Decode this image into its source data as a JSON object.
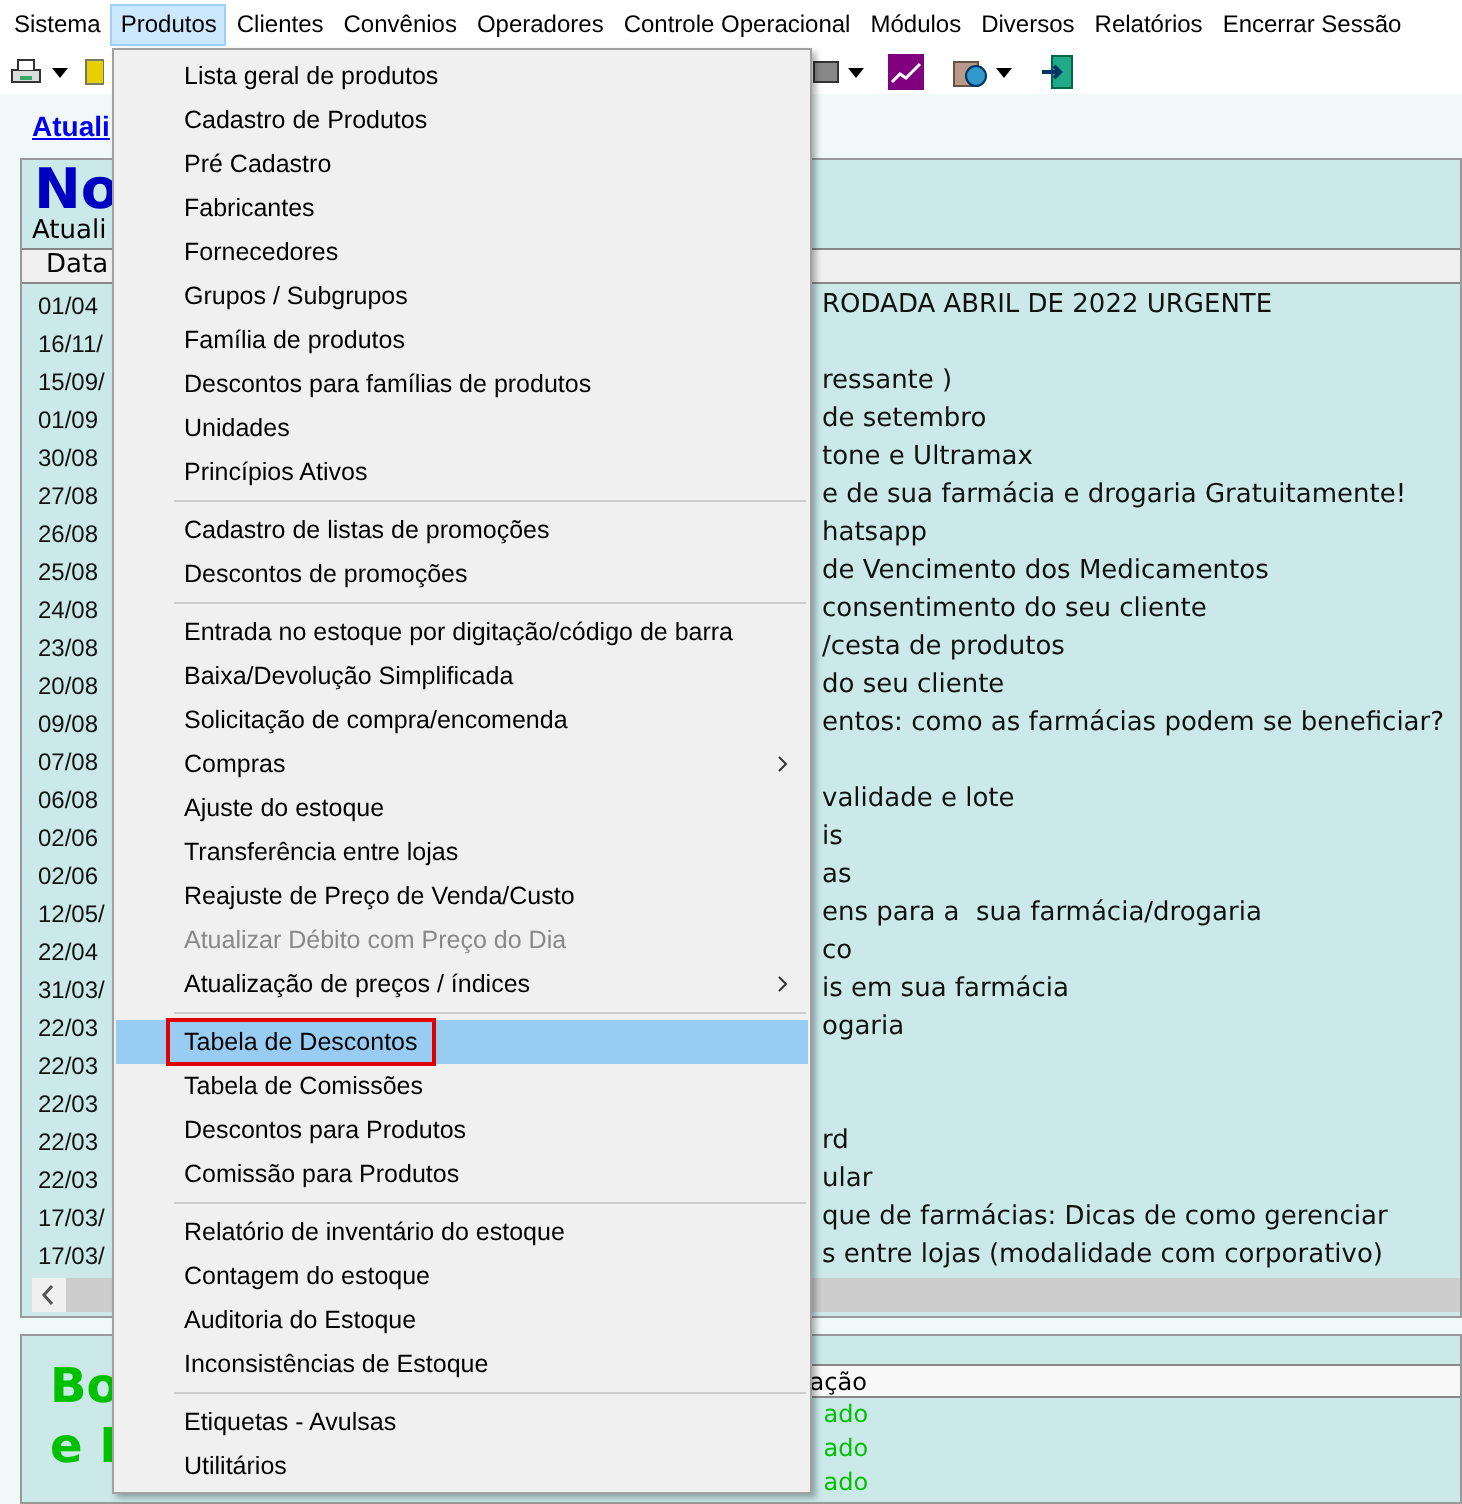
{
  "menu_bar": [
    {
      "label": "Sistema",
      "selected": false
    },
    {
      "label": "Produtos",
      "selected": true
    },
    {
      "label": "Clientes",
      "selected": false
    },
    {
      "label": "Convênios",
      "selected": false
    },
    {
      "label": "Operadores",
      "selected": false
    },
    {
      "label": "Controle Operacional",
      "selected": false
    },
    {
      "label": "Módulos",
      "selected": false
    },
    {
      "label": "Diversos",
      "selected": false
    },
    {
      "label": "Relatórios",
      "selected": false
    },
    {
      "label": "Encerrar Sessão",
      "selected": false
    }
  ],
  "link": "Atuali",
  "news": {
    "title": "No",
    "subtitle": "Atuali",
    "column": "Data",
    "rows": [
      {
        "date": "01/04",
        "text": "RODADA ABRIL DE 2022 URGENTE"
      },
      {
        "date": "16/11/",
        "text": ""
      },
      {
        "date": "15/09/",
        "text": "ressante )"
      },
      {
        "date": "01/09",
        "text": "de setembro"
      },
      {
        "date": "30/08",
        "text": "tone e Ultramax"
      },
      {
        "date": "27/08",
        "text": "e de sua farmácia e drogaria Gratuitamente!"
      },
      {
        "date": "26/08",
        "text": "hatsapp"
      },
      {
        "date": "25/08",
        "text": "de Vencimento dos Medicamentos"
      },
      {
        "date": "24/08",
        "text": "consentimento do seu cliente"
      },
      {
        "date": "23/08",
        "text": "/cesta de produtos"
      },
      {
        "date": "20/08",
        "text": "do seu cliente"
      },
      {
        "date": "09/08",
        "text": "entos: como as farmácias podem se beneficiar?"
      },
      {
        "date": "07/08",
        "text": ""
      },
      {
        "date": "06/08",
        "text": "validade e lote"
      },
      {
        "date": "02/06",
        "text": "is"
      },
      {
        "date": "02/06",
        "text": "as"
      },
      {
        "date": "12/05/",
        "text": "ens para a  sua farmácia/drogaria"
      },
      {
        "date": "22/04",
        "text": "co"
      },
      {
        "date": "31/03/",
        "text": "is em sua farmácia"
      },
      {
        "date": "22/03",
        "text": "ogaria"
      },
      {
        "date": "22/03",
        "text": ""
      },
      {
        "date": "22/03",
        "text": ""
      },
      {
        "date": "22/03",
        "text": "rd"
      },
      {
        "date": "22/03",
        "text": "ular"
      },
      {
        "date": "17/03/",
        "text": "que de farmácias: Dicas de como gerenciar"
      },
      {
        "date": "17/03/",
        "text": "s entre lojas (modalidade com corporativo)"
      }
    ]
  },
  "bottom_panel": {
    "title_lines": [
      "Bo",
      "e I"
    ],
    "column": "ação",
    "rows": [
      "ado",
      "ado",
      "ado"
    ]
  },
  "dropdown": [
    {
      "kind": "item",
      "label": "Lista geral de produtos",
      "selected": false,
      "disabled": false,
      "submenu": false
    },
    {
      "kind": "item",
      "label": "Cadastro de Produtos",
      "selected": false,
      "disabled": false,
      "submenu": false
    },
    {
      "kind": "item",
      "label": "Pré Cadastro",
      "selected": false,
      "disabled": false,
      "submenu": false
    },
    {
      "kind": "item",
      "label": "Fabricantes",
      "selected": false,
      "disabled": false,
      "submenu": false
    },
    {
      "kind": "item",
      "label": "Fornecedores",
      "selected": false,
      "disabled": false,
      "submenu": false
    },
    {
      "kind": "item",
      "label": "Grupos / Subgrupos",
      "selected": false,
      "disabled": false,
      "submenu": false
    },
    {
      "kind": "item",
      "label": "Família de produtos",
      "selected": false,
      "disabled": false,
      "submenu": false
    },
    {
      "kind": "item",
      "label": "Descontos para famílias de produtos",
      "selected": false,
      "disabled": false,
      "submenu": false
    },
    {
      "kind": "item",
      "label": "Unidades",
      "selected": false,
      "disabled": false,
      "submenu": false
    },
    {
      "kind": "item",
      "label": "Princípios Ativos",
      "selected": false,
      "disabled": false,
      "submenu": false
    },
    {
      "kind": "separator"
    },
    {
      "kind": "item",
      "label": "Cadastro de listas de promoções",
      "selected": false,
      "disabled": false,
      "submenu": false
    },
    {
      "kind": "item",
      "label": "Descontos de promoções",
      "selected": false,
      "disabled": false,
      "submenu": false
    },
    {
      "kind": "separator"
    },
    {
      "kind": "item",
      "label": "Entrada no estoque por digitação/código de barra",
      "selected": false,
      "disabled": false,
      "submenu": false
    },
    {
      "kind": "item",
      "label": "Baixa/Devolução Simplificada",
      "selected": false,
      "disabled": false,
      "submenu": false
    },
    {
      "kind": "item",
      "label": "Solicitação de compra/encomenda",
      "selected": false,
      "disabled": false,
      "submenu": false
    },
    {
      "kind": "item",
      "label": "Compras",
      "selected": false,
      "disabled": false,
      "submenu": true
    },
    {
      "kind": "item",
      "label": "Ajuste do estoque",
      "selected": false,
      "disabled": false,
      "submenu": false
    },
    {
      "kind": "item",
      "label": "Transferência entre lojas",
      "selected": false,
      "disabled": false,
      "submenu": false
    },
    {
      "kind": "item",
      "label": "Reajuste de Preço de Venda/Custo",
      "selected": false,
      "disabled": false,
      "submenu": false
    },
    {
      "kind": "item",
      "label": "Atualizar Débito com Preço do Dia",
      "selected": false,
      "disabled": true,
      "submenu": false
    },
    {
      "kind": "item",
      "label": "Atualização de preços / índices",
      "selected": false,
      "disabled": false,
      "submenu": true
    },
    {
      "kind": "separator"
    },
    {
      "kind": "item",
      "label": "Tabela de Descontos",
      "selected": true,
      "disabled": false,
      "submenu": false
    },
    {
      "kind": "item",
      "label": "Tabela de Comissões",
      "selected": false,
      "disabled": false,
      "submenu": false
    },
    {
      "kind": "item",
      "label": "Descontos para Produtos",
      "selected": false,
      "disabled": false,
      "submenu": false
    },
    {
      "kind": "item",
      "label": "Comissão para Produtos",
      "selected": false,
      "disabled": false,
      "submenu": false
    },
    {
      "kind": "separator"
    },
    {
      "kind": "item",
      "label": "Relatório de inventário do estoque",
      "selected": false,
      "disabled": false,
      "submenu": false
    },
    {
      "kind": "item",
      "label": "Contagem do estoque",
      "selected": false,
      "disabled": false,
      "submenu": false
    },
    {
      "kind": "item",
      "label": "Auditoria do Estoque",
      "selected": false,
      "disabled": false,
      "submenu": false
    },
    {
      "kind": "item",
      "label": "Inconsistências de Estoque",
      "selected": false,
      "disabled": false,
      "submenu": false
    },
    {
      "kind": "separator"
    },
    {
      "kind": "item",
      "label": "Etiquetas - Avulsas",
      "selected": false,
      "disabled": false,
      "submenu": false
    },
    {
      "kind": "item",
      "label": "Utilitários",
      "selected": false,
      "disabled": false,
      "submenu": false
    }
  ]
}
